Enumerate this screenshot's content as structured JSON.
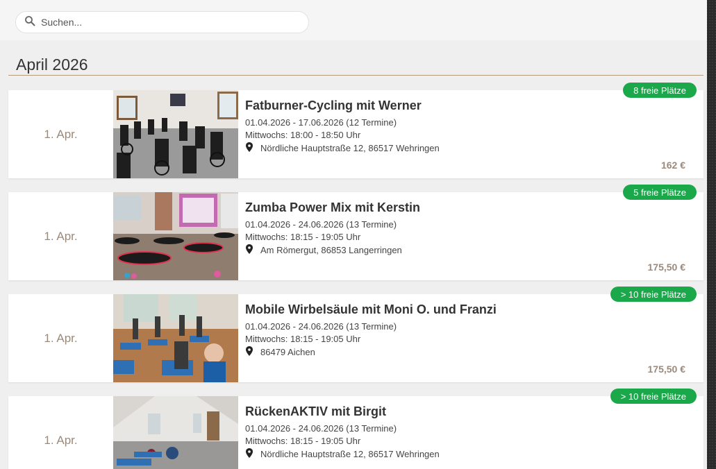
{
  "search": {
    "placeholder": "Suchen..."
  },
  "month": {
    "title": "April 2026"
  },
  "courses": [
    {
      "date": "1. Apr.",
      "title": "Fatburner-Cycling mit Werner",
      "period": "01.04.2026 - 17.06.2026 (12 Termine)",
      "schedule": "Mittwochs: 18:00 - 18:50 Uhr",
      "location": "Nördliche Hauptstraße 12, 86517 Wehringen",
      "price": "162 €",
      "badge": "8 freie Plätze",
      "image": "spinning-room-image"
    },
    {
      "date": "1. Apr.",
      "title": "Zumba Power Mix mit Kerstin",
      "period": "01.04.2026 - 24.06.2026 (13 Termine)",
      "schedule": "Mittwochs: 18:15 - 19:05 Uhr",
      "location": "Am Römergut, 86853 Langerringen",
      "price": "175,50 €",
      "badge": "5 freie Plätze",
      "image": "zumba-trampoline-image"
    },
    {
      "date": "1. Apr.",
      "title": "Mobile Wirbelsäule mit Moni O. und Franzi",
      "period": "01.04.2026 - 24.06.2026 (13 Termine)",
      "schedule": "Mittwochs: 18:15 - 19:05 Uhr",
      "location": "86479 Aichen",
      "price": "175,50 €",
      "badge": "> 10 freie Plätze",
      "image": "gymnastics-class-image"
    },
    {
      "date": "1. Apr.",
      "title": "RückenAKTIV mit Birgit",
      "period": "01.04.2026 - 24.06.2026 (13 Termine)",
      "schedule": "Mittwochs: 18:15 - 19:05 Uhr",
      "location": "Nördliche Hauptstraße 12, 86517 Wehringen",
      "price": "",
      "badge": "> 10 freie Plätze",
      "image": "attic-studio-image"
    }
  ],
  "icons": {
    "search": "search-icon",
    "location": "location-pin-icon"
  },
  "colors": {
    "badge": "#1aa84a",
    "price": "#9a8a7c",
    "rule": "#b79a80"
  }
}
